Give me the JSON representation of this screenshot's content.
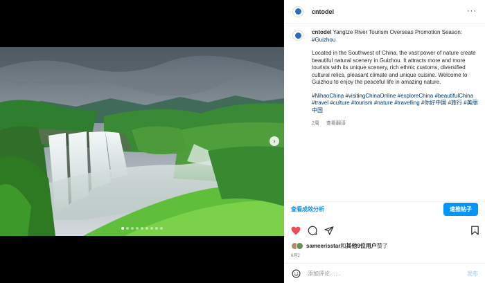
{
  "post": {
    "username": "cntodel",
    "caption_title": "Yangtze River Tourism Overseas Promotion Season:",
    "caption_title_tag": "#Guizhou",
    "caption_body": "Located in the Southwest of China, the vast power of nature create beautiful natural scenery in Guizhou. It attracts more and more tourists with its unique scenery, rich ethnic customs, diversified cultural relics, pleasant climate and unique cuisine. Welcome to Guizhou to enjoy the peaceful life in amazing nature.",
    "hashtags": "#NihaoChina #visitingChinaOnline #exploreChina #beautifulChina #travel #culture #tourism #nature #travelling #你好中国 #旅行 #美丽中国",
    "age": "2周",
    "translate": "查看翻译",
    "ad_link": "查看成效分析",
    "ad_button": "速推帖子",
    "liked_by_user": "sameerisstar",
    "liked_by_mid": "和",
    "liked_by_others": "其他9位用户",
    "liked_by_end": "赞了",
    "date": "6月2",
    "comment_placeholder": "添加评论……",
    "post_button": "发布"
  },
  "carousel": {
    "total": 9,
    "current": 1
  },
  "colors": {
    "accent": "#0095f6",
    "like": "#ed4956",
    "link": "#00376b"
  },
  "icons": [
    "more-icon",
    "heart-icon",
    "comment-icon",
    "share-icon",
    "save-icon",
    "emoji-icon",
    "chevron-right-icon"
  ]
}
